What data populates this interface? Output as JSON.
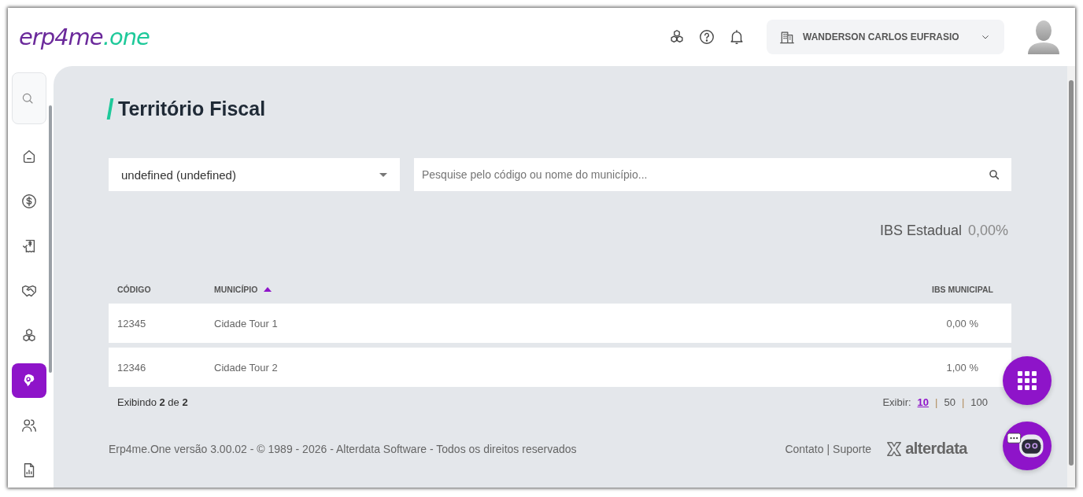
{
  "logo": {
    "brand": "erp4me",
    "suffix": ".one"
  },
  "header": {
    "company": "WANDERSON CARLOS EUFRASIO"
  },
  "sidebar": {
    "items": [
      {
        "kind": "home",
        "selected": false
      },
      {
        "kind": "dollar",
        "selected": false
      },
      {
        "kind": "receipt",
        "selected": false
      },
      {
        "kind": "handshake",
        "selected": false
      },
      {
        "kind": "cubes",
        "selected": false
      },
      {
        "kind": "map",
        "selected": true
      },
      {
        "kind": "users",
        "selected": false
      },
      {
        "kind": "report",
        "selected": false
      }
    ]
  },
  "page": {
    "title": "Território Fiscal"
  },
  "filters": {
    "state_select": {
      "value": "undefined (undefined)"
    },
    "search": {
      "placeholder": "Pesquise pelo código ou nome do município..."
    }
  },
  "ibs_estadual": {
    "label": "IBS Estadual",
    "value": "0,00%"
  },
  "table": {
    "columns": [
      {
        "label": "CÓDIGO",
        "sorted": false
      },
      {
        "label": "MUNICÍPIO",
        "sorted": true
      },
      {
        "label": "IBS MUNICIPAL",
        "sorted": false
      }
    ],
    "rows": [
      {
        "code": "12345",
        "city": "Cidade Tour 1",
        "ibs": "0,00 %"
      },
      {
        "code": "12346",
        "city": "Cidade Tour 2",
        "ibs": "1,00 %"
      }
    ]
  },
  "pagination": {
    "summary": "Exibindo **2** de **2**",
    "label": "Exibir:",
    "separator": "|",
    "sizes": [
      {
        "label": "10",
        "selected": true
      },
      {
        "label": "50",
        "selected": false
      },
      {
        "label": "100",
        "selected": false
      }
    ]
  },
  "footer": {
    "copyright": "Erp4me.One versão 3.00.02 - © 1989 - 2026 - Alterdata Software - Todos os direitos reservados",
    "links": [
      "Contato",
      "Suporte"
    ],
    "separator": "|",
    "brand": "alterdata"
  }
}
